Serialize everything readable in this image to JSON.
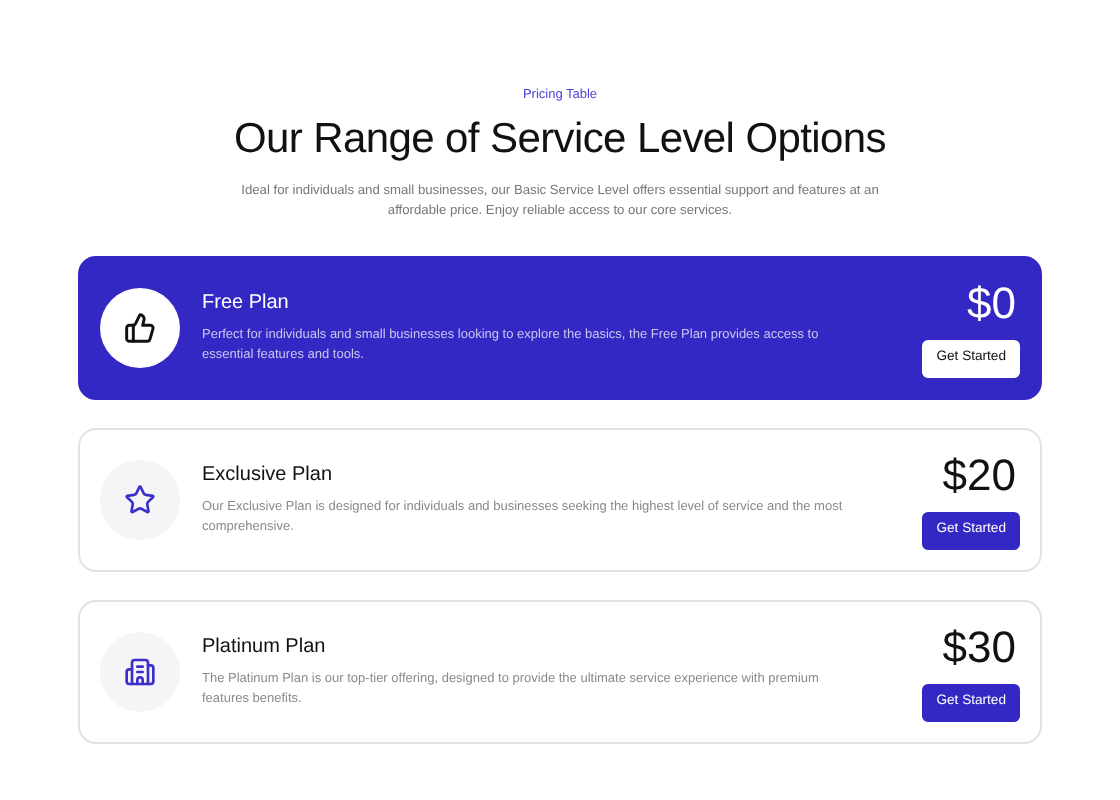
{
  "header": {
    "eyebrow": "Pricing Table",
    "title": "Our Range of Service Level Options",
    "subtitle": "Ideal for individuals and small businesses, our Basic Service Level offers essential support and features at an affordable price. Enjoy reliable access to our core services."
  },
  "plans": [
    {
      "kind": "thumbs",
      "selected": true,
      "name": "Free Plan",
      "description": "Perfect for individuals and small businesses looking to explore the basics, the Free Plan provides access to essential features and tools.",
      "price": "$0",
      "button": "Get Started"
    },
    {
      "kind": "star",
      "selected": false,
      "name": "Exclusive Plan",
      "description": "Our Exclusive Plan is designed for individuals and businesses seeking the highest level of service and the most comprehensive.",
      "price": "$20",
      "button": "Get Started"
    },
    {
      "kind": "building",
      "selected": false,
      "name": "Platinum Plan",
      "description": "The Platinum Plan is our top-tier offering, designed to provide the ultimate service experience with premium features benefits.",
      "price": "$30",
      "button": "Get Started"
    }
  ]
}
